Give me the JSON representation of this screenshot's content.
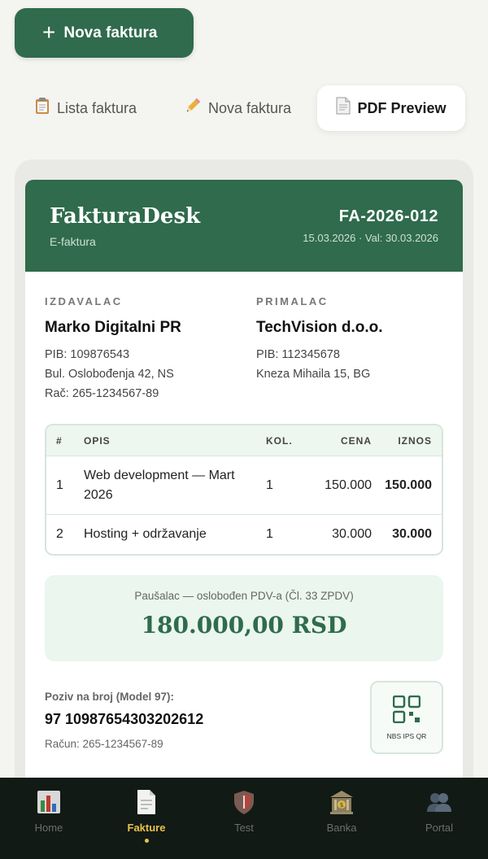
{
  "actions": {
    "new_invoice_label": "Nova faktura"
  },
  "tabs": [
    {
      "label": "Lista faktura",
      "icon": "clipboard-icon"
    },
    {
      "label": "Nova faktura",
      "icon": "pencil-icon"
    },
    {
      "label": "PDF Preview",
      "icon": "document-icon",
      "active": true
    }
  ],
  "invoice": {
    "brand": "FakturaDesk",
    "brand_sub": "E-faktura",
    "number": "FA-2026-012",
    "dates": "15.03.2026 · Val: 30.03.2026",
    "issuer": {
      "label": "IZDAVALAC",
      "name": "Marko Digitalni PR",
      "pib": "PIB: 109876543",
      "address": "Bul. Oslobođenja 42, NS",
      "account": "Rač: 265-1234567-89"
    },
    "recipient": {
      "label": "PRIMALAC",
      "name": "TechVision d.o.o.",
      "pib": "PIB: 112345678",
      "address": "Kneza Mihaila 15, BG"
    },
    "table": {
      "headers": [
        "#",
        "OPIS",
        "KOL.",
        "CENA",
        "IZNOS"
      ],
      "rows": [
        {
          "num": "1",
          "desc": "Web development — Mart 2026",
          "qty": "1",
          "price": "150.000",
          "amount": "150.000"
        },
        {
          "num": "2",
          "desc": "Hosting + održavanje",
          "qty": "1",
          "price": "30.000",
          "amount": "30.000"
        }
      ]
    },
    "total_note": "Paušalac — oslobođen PDV-a (Čl. 33 ZPDV)",
    "total": "180.000,00 RSD",
    "reference_label": "Poziv na broj (Model 97):",
    "reference": "97 10987654303202612",
    "account_line": "Račun: 265-1234567-89",
    "qr_label": "NBS IPS QR"
  },
  "nav": [
    {
      "label": "Home",
      "icon": "chart-icon"
    },
    {
      "label": "Fakture",
      "icon": "invoice-icon",
      "active": true
    },
    {
      "label": "Test",
      "icon": "shield-icon"
    },
    {
      "label": "Banka",
      "icon": "bank-icon"
    },
    {
      "label": "Portal",
      "icon": "users-icon"
    }
  ],
  "colors": {
    "primary": "#2f6b4c",
    "accent": "#e8c24a",
    "nav_bg": "#111a14"
  }
}
